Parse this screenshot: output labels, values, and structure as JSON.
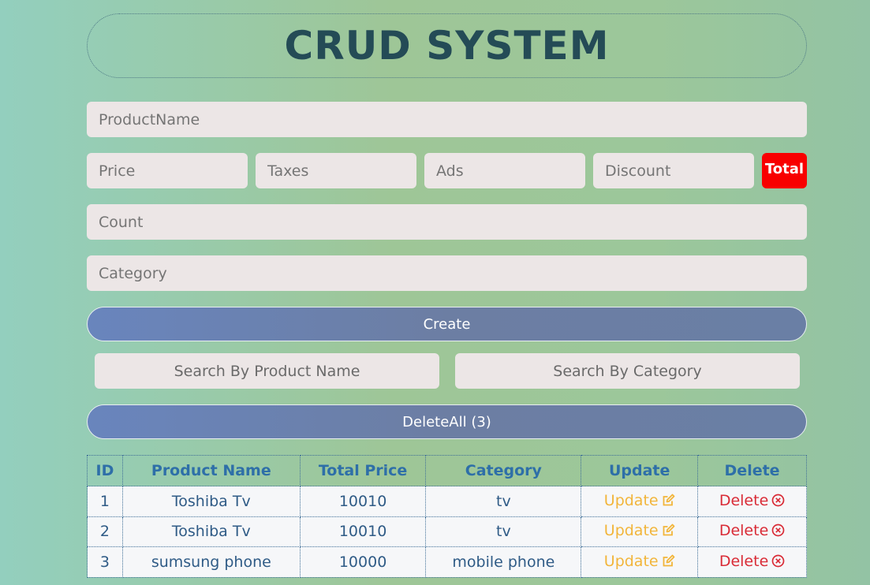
{
  "title": "CRUD SYSTEM",
  "form": {
    "product_placeholder": "ProductName",
    "price_placeholder": "Price",
    "taxes_placeholder": "Taxes",
    "ads_placeholder": "Ads",
    "discount_placeholder": "Discount",
    "total_label": "Total",
    "count_placeholder": "Count",
    "category_placeholder": "Category",
    "create_label": "Create"
  },
  "search": {
    "by_name_label": "Search By Product Name",
    "by_category_label": "Search By Category"
  },
  "delete_all_label": "DeleteAll (3)",
  "table": {
    "headers": [
      "ID",
      "Product Name",
      "Total Price",
      "Category",
      "Update",
      "Delete"
    ],
    "rows": [
      {
        "id": "1",
        "name": "Toshiba Tv",
        "total": "10010",
        "category": "tv",
        "update": "Update",
        "delete": "Delete"
      },
      {
        "id": "2",
        "name": "Toshiba Tv",
        "total": "10010",
        "category": "tv",
        "update": "Update",
        "delete": "Delete"
      },
      {
        "id": "3",
        "name": "sumsung phone",
        "total": "10000",
        "category": "mobile phone",
        "update": "Update",
        "delete": "Delete"
      }
    ]
  },
  "icons": {
    "update": "edit-icon",
    "delete": "circle-x-icon"
  },
  "colors": {
    "total_badge": "#f80000",
    "title": "#244b56",
    "update": "#f2b53a",
    "delete": "#d92b36",
    "header": "#2e6fa8"
  }
}
